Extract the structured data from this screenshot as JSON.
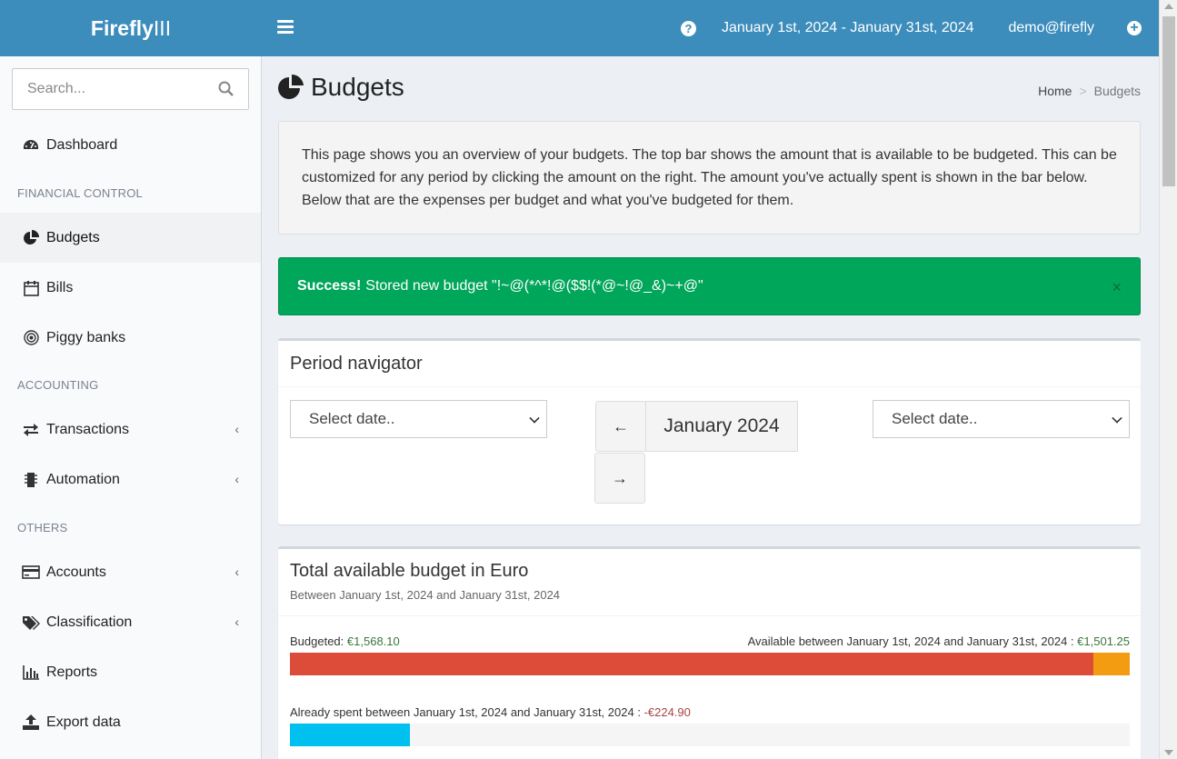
{
  "brand": {
    "bold": "Firefly",
    "light": "III"
  },
  "header": {
    "daterange": "January 1st, 2024 - January 31st, 2024",
    "user": "demo@firefly"
  },
  "search": {
    "placeholder": "Search..."
  },
  "sidebar": {
    "headers": [
      "FINANCIAL CONTROL",
      "ACCOUNTING",
      "OTHERS"
    ],
    "items": [
      {
        "label": "Dashboard",
        "icon": "dashboard-icon"
      },
      {
        "label": "Budgets",
        "icon": "pie-chart-icon",
        "active": true
      },
      {
        "label": "Bills",
        "icon": "calendar-icon"
      },
      {
        "label": "Piggy banks",
        "icon": "bullseye-icon"
      },
      {
        "label": "Transactions",
        "icon": "exchange-icon",
        "expandable": true
      },
      {
        "label": "Automation",
        "icon": "microchip-icon",
        "expandable": true
      },
      {
        "label": "Accounts",
        "icon": "credit-card-icon",
        "expandable": true
      },
      {
        "label": "Classification",
        "icon": "tags-icon",
        "expandable": true
      },
      {
        "label": "Reports",
        "icon": "bar-chart-icon"
      },
      {
        "label": "Export data",
        "icon": "upload-icon"
      }
    ]
  },
  "page": {
    "title": "Budgets",
    "breadcrumb": {
      "home": "Home",
      "current": "Budgets"
    }
  },
  "callout": "This page shows you an overview of your budgets. The top bar shows the amount that is available to be budgeted. This can be customized for any period by clicking the amount on the right. The amount you've actually spent is shown in the bar below. Below that are the expenses per budget and what you've budgeted for them.",
  "alert": {
    "strong": "Success!",
    "text": "Stored new budget \"!~@(*^*!@($$!(*@~!@_&)~+@\"",
    "close": "×"
  },
  "period_navigator": {
    "title": "Period navigator",
    "select_left": "Select date..",
    "select_right": "Select date..",
    "prev": "←",
    "next": "→",
    "current": "January 2024"
  },
  "available_budget": {
    "title": "Total available budget in Euro",
    "subtitle": "Between January 1st, 2024 and January 31st, 2024",
    "budgeted_label": "Budgeted:",
    "budgeted_amount": "€1,568.10",
    "available_label": "Available between January 1st, 2024 and January 31st, 2024 :",
    "available_amount": "€1,501.25",
    "spent_label": "Already spent between January 1st, 2024 and January 31st, 2024 :",
    "spent_amount": "-€224.90",
    "budgeted_fraction": 0.957,
    "spent_fraction": 0.143,
    "colors": {
      "budgeted": "#dd4b39",
      "over": "#f39c12",
      "spent": "#00c0ef",
      "track": "#f5f5f5"
    }
  }
}
